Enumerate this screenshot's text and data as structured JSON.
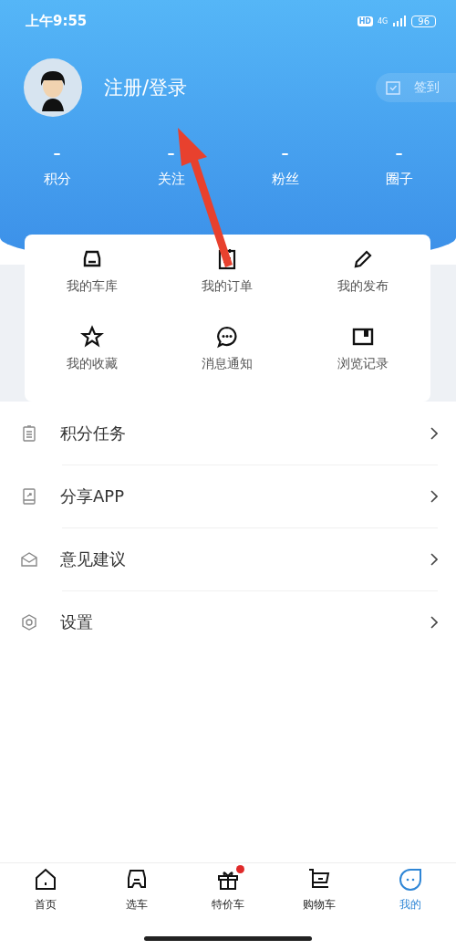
{
  "status_bar": {
    "time": "上午9:55",
    "hd": "HD",
    "network": "4G",
    "battery": "96"
  },
  "profile": {
    "login": "注册/登录",
    "sign_in": "签到"
  },
  "stats": [
    {
      "value": "–",
      "label": "积分"
    },
    {
      "value": "–",
      "label": "关注"
    },
    {
      "value": "–",
      "label": "粉丝"
    },
    {
      "value": "–",
      "label": "圈子"
    }
  ],
  "shortcuts": [
    {
      "label": "我的车库"
    },
    {
      "label": "我的订单"
    },
    {
      "label": "我的发布"
    },
    {
      "label": "我的收藏"
    },
    {
      "label": "消息通知"
    },
    {
      "label": "浏览记录"
    }
  ],
  "menu": [
    {
      "label": "积分任务"
    },
    {
      "label": "分享APP"
    },
    {
      "label": "意见建议"
    },
    {
      "label": "设置"
    }
  ],
  "tab_bar": [
    {
      "label": "首页",
      "selected": false,
      "badge": false
    },
    {
      "label": "选车",
      "selected": false,
      "badge": false
    },
    {
      "label": "特价车",
      "selected": false,
      "badge": true
    },
    {
      "label": "购物车",
      "selected": false,
      "badge": false
    },
    {
      "label": "我的",
      "selected": true,
      "badge": false
    }
  ]
}
